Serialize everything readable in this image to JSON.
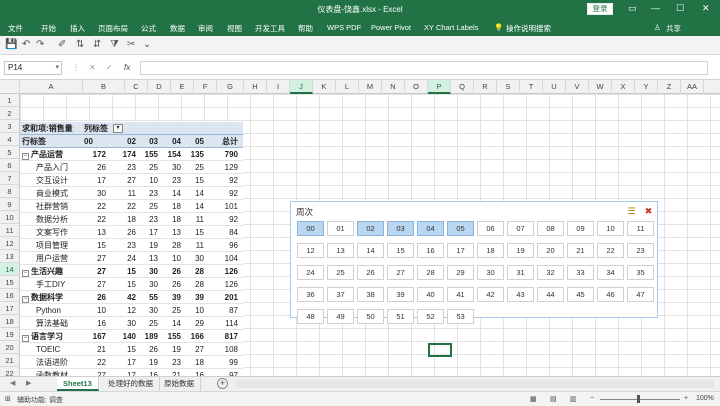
{
  "window": {
    "title": "仪表盘-饶鑫.xlsx  -  Excel",
    "login_label": "登录",
    "restore_icon": "▭",
    "minimize_icon": "—",
    "maximize_icon": "☐",
    "close_icon": "✕"
  },
  "ribbon": {
    "tabs": [
      "文件",
      "开始",
      "插入",
      "页面布局",
      "公式",
      "数据",
      "审阅",
      "视图",
      "开发工具",
      "帮助",
      "WPS PDF",
      "Power Pivot",
      "XY Chart Labels"
    ],
    "tell_me": "操作说明搜索",
    "share": "共享"
  },
  "formula_bar": {
    "name_box": "P14",
    "cancel": "✕",
    "enter": "✓",
    "fx": "fx",
    "value": ""
  },
  "columns": [
    "A",
    "B",
    "C",
    "D",
    "E",
    "F",
    "G",
    "H",
    "I",
    "J",
    "K",
    "L",
    "M",
    "N",
    "O",
    "P",
    "Q",
    "R",
    "S",
    "T",
    "U",
    "V",
    "W",
    "X",
    "Y",
    "Z",
    "AA"
  ],
  "rows": [
    "1",
    "2",
    "3",
    "4",
    "5",
    "6",
    "7",
    "8",
    "9",
    "10",
    "11",
    "12",
    "13",
    "14",
    "15",
    "16",
    "17",
    "18",
    "19",
    "20",
    "21",
    "22"
  ],
  "pivot": {
    "header_label": "求和项:销售量",
    "col_label": "列标签",
    "row_label": "行标签",
    "col_headers": [
      "00",
      "02",
      "03",
      "04",
      "05",
      "总计"
    ],
    "rows": [
      {
        "label": "产品运营",
        "values": [
          "172",
          "174",
          "155",
          "154",
          "135",
          "790"
        ],
        "group": true
      },
      {
        "label": "产品入门",
        "values": [
          "26",
          "23",
          "25",
          "30",
          "25",
          "129"
        ]
      },
      {
        "label": "交互设计",
        "values": [
          "17",
          "27",
          "10",
          "23",
          "15",
          "92"
        ]
      },
      {
        "label": "商业模式",
        "values": [
          "30",
          "11",
          "23",
          "14",
          "14",
          "92"
        ]
      },
      {
        "label": "社群营销",
        "values": [
          "22",
          "22",
          "25",
          "18",
          "14",
          "101"
        ]
      },
      {
        "label": "数据分析",
        "values": [
          "22",
          "18",
          "23",
          "18",
          "11",
          "92"
        ]
      },
      {
        "label": "文案写作",
        "values": [
          "13",
          "26",
          "17",
          "13",
          "15",
          "84"
        ]
      },
      {
        "label": "项目管理",
        "values": [
          "15",
          "23",
          "19",
          "28",
          "11",
          "96"
        ]
      },
      {
        "label": "用户运营",
        "values": [
          "27",
          "24",
          "13",
          "10",
          "30",
          "104"
        ]
      },
      {
        "label": "生活兴趣",
        "values": [
          "27",
          "15",
          "30",
          "26",
          "28",
          "126"
        ],
        "group": true
      },
      {
        "label": "手工DIY",
        "values": [
          "27",
          "15",
          "30",
          "26",
          "28",
          "126"
        ]
      },
      {
        "label": "数据科学",
        "values": [
          "26",
          "42",
          "55",
          "39",
          "39",
          "201"
        ],
        "group": true
      },
      {
        "label": "Python",
        "values": [
          "10",
          "12",
          "30",
          "25",
          "10",
          "87"
        ]
      },
      {
        "label": "算法基础",
        "values": [
          "16",
          "30",
          "25",
          "14",
          "29",
          "114"
        ]
      },
      {
        "label": "语言学习",
        "values": [
          "167",
          "140",
          "189",
          "155",
          "166",
          "817"
        ],
        "group": true
      },
      {
        "label": "TOEIC",
        "values": [
          "21",
          "15",
          "26",
          "19",
          "27",
          "108"
        ]
      },
      {
        "label": "法语进阶",
        "values": [
          "22",
          "17",
          "19",
          "23",
          "18",
          "99"
        ]
      },
      {
        "label": "函数教材",
        "values": [
          "27",
          "17",
          "16",
          "21",
          "16",
          "97"
        ]
      }
    ]
  },
  "slicer": {
    "title": "周次",
    "multiselect_icon": "☰",
    "clear_filter_icon": "✖",
    "items": [
      "00",
      "01",
      "02",
      "03",
      "04",
      "05",
      "06",
      "07",
      "08",
      "09",
      "10",
      "11",
      "12",
      "13",
      "14",
      "15",
      "16",
      "17",
      "18",
      "19",
      "20",
      "21",
      "22",
      "23",
      "24",
      "25",
      "26",
      "27",
      "28",
      "29",
      "30",
      "31",
      "32",
      "33",
      "34",
      "35",
      "36",
      "37",
      "38",
      "39",
      "40",
      "41",
      "42",
      "43",
      "44",
      "45",
      "46",
      "47",
      "48",
      "49",
      "50",
      "51",
      "52",
      "53"
    ],
    "selected": [
      "00",
      "02",
      "03",
      "04",
      "05"
    ]
  },
  "sheets": {
    "tabs": [
      "Sheet13",
      "处理好的数据",
      "原始数据"
    ],
    "active": "Sheet13",
    "nav_prev": "◀",
    "nav_next": "▶",
    "add": "+"
  },
  "status": {
    "accessibility": "辅助功能: 调查",
    "zoom": "100%",
    "minus": "−",
    "plus": "+"
  },
  "colors": {
    "accent": "#217346",
    "slicer_selected": "#bad7f2",
    "pivot_header": "#dce6f1"
  }
}
